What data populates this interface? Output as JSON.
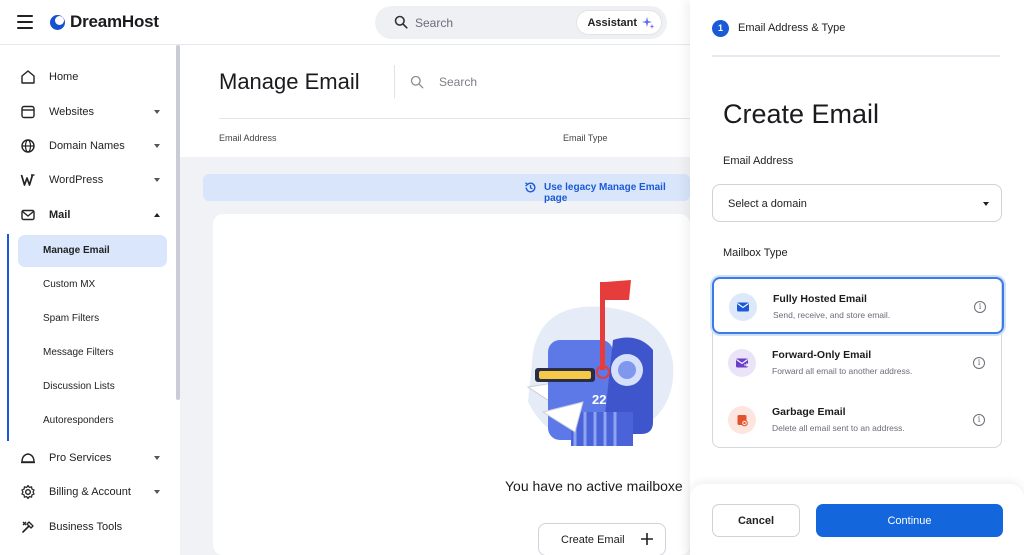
{
  "brand": {
    "name": "DreamHost"
  },
  "topbar": {
    "search_placeholder": "Search",
    "assistant_label": "Assistant"
  },
  "sidebar": {
    "items": [
      {
        "label": "Home",
        "icon": "home-icon"
      },
      {
        "label": "Websites",
        "icon": "window-icon"
      },
      {
        "label": "Domain Names",
        "icon": "globe-icon"
      },
      {
        "label": "WordPress",
        "icon": "wordpress-icon"
      },
      {
        "label": "Mail",
        "icon": "mail-icon"
      }
    ],
    "mail_sub": [
      "Manage Email",
      "Custom MX",
      "Spam Filters",
      "Message Filters",
      "Discussion Lists",
      "Autoresponders"
    ],
    "lower_items": [
      {
        "label": "Pro Services",
        "icon": "hard-hat-icon"
      },
      {
        "label": "Billing & Account",
        "icon": "gear-icon"
      },
      {
        "label": "Business Tools",
        "icon": "tools-icon"
      }
    ]
  },
  "main": {
    "title": "Manage Email",
    "search_placeholder": "Search",
    "columns": [
      "Email Address",
      "Email Type"
    ],
    "legacy_link": "Use legacy Manage Email page",
    "empty_text": "You have no active mailboxe",
    "create_button": "Create Email",
    "mailbox_number": "22"
  },
  "panel": {
    "step_number": "1",
    "step_label": "Email Address & Type",
    "title": "Create Email",
    "email_address_label": "Email Address",
    "domain_select": "Select a domain",
    "mailbox_type_label": "Mailbox Type",
    "types": [
      {
        "title": "Fully Hosted Email",
        "desc": "Send, receive, and store email.",
        "icon": "envelope-icon",
        "color": "#1a5ad8",
        "bg": "#dde8fb"
      },
      {
        "title": "Forward-Only Email",
        "desc": "Forward all email to another address.",
        "icon": "forward-envelope-icon",
        "color": "#6b3fc7",
        "bg": "#ebe4f8"
      },
      {
        "title": "Garbage Email",
        "desc": "Delete all email sent to an address.",
        "icon": "trash-mail-icon",
        "color": "#e2522f",
        "bg": "#fde6df"
      }
    ],
    "selected_type": "Fully Hosted Email",
    "cancel_label": "Cancel",
    "continue_label": "Continue"
  },
  "colors": {
    "accent": "#1466dd",
    "rail": "#1a5ad8",
    "active_bg": "#d9e6fb"
  }
}
